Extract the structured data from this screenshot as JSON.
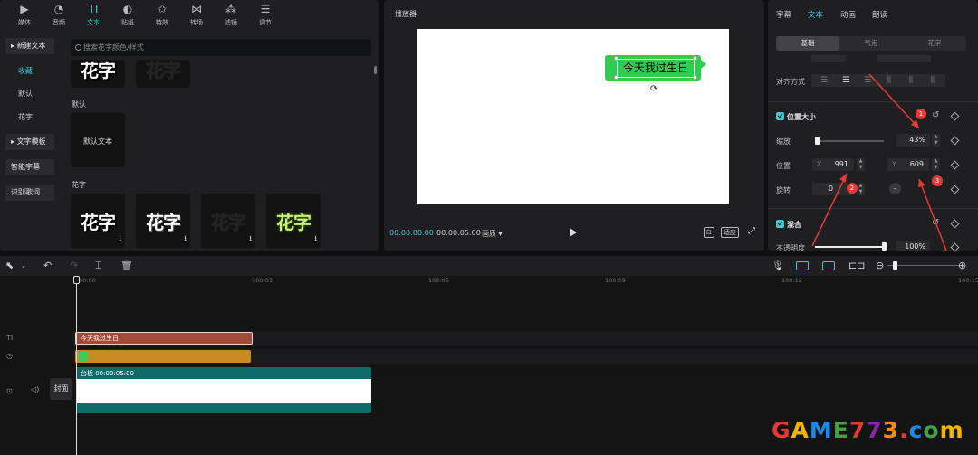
{
  "toolbar": {
    "tools": [
      {
        "label": "媒体",
        "icon": "media-icon",
        "glyph": "▶"
      },
      {
        "label": "音频",
        "icon": "audio-icon",
        "glyph": "◔"
      },
      {
        "label": "文本",
        "icon": "text-icon",
        "glyph": "TI"
      },
      {
        "label": "贴纸",
        "icon": "sticker-icon",
        "glyph": "◐"
      },
      {
        "label": "特效",
        "icon": "effects-icon",
        "glyph": "✩"
      },
      {
        "label": "转场",
        "icon": "transition-icon",
        "glyph": "⋈"
      },
      {
        "label": "滤镜",
        "icon": "filter-icon",
        "glyph": "⁂"
      },
      {
        "label": "调节",
        "icon": "adjust-icon",
        "glyph": "☰"
      }
    ],
    "active": "文本"
  },
  "left_nav": {
    "new_text": "新建文本",
    "favorites": "收藏",
    "default": "默认",
    "fancy": "花字",
    "text_template": "文字模板",
    "smart_caption": "智能字幕",
    "lyrics": "识别歌词"
  },
  "search": {
    "placeholder": "搜索花字颜色/样式"
  },
  "library": {
    "default_section": "默认",
    "default_tile": "默认文本",
    "fancy_section": "花字",
    "fancy_tiles": [
      "花字",
      "花字",
      "花字",
      "花字"
    ],
    "top_tiles": [
      "花字",
      "花字"
    ]
  },
  "player": {
    "title": "播放器",
    "caption_text": "今天我过生日",
    "time_current": "00:00:00:00",
    "time_total": "00:00:05:00",
    "ratio": "画质 ▾",
    "tools": [
      "⊡",
      "适应",
      "⤢"
    ]
  },
  "right_panel": {
    "tabs": [
      "字幕",
      "文本",
      "动画",
      "朗读"
    ],
    "active_tab": "文本",
    "segments": [
      "基础",
      "气泡",
      "花字"
    ],
    "active_segment": "基础",
    "align_label": "对齐方式",
    "pos_size_label": "位置大小",
    "scale_label": "缩放",
    "scale_value": "43%",
    "scale_level": 0.43,
    "position_label": "位置",
    "x_label": "X",
    "x_value": "991",
    "y_label": "Y",
    "y_value": "609",
    "rotate_label": "旋转",
    "rotate_value": "0",
    "mix_label": "混合",
    "opacity_label": "不透明度",
    "opacity_value": "100%",
    "opacity_level": 1.0
  },
  "annotations": [
    "1",
    "2",
    "3"
  ],
  "timeline": {
    "ruler": [
      "00:00",
      "100:03",
      "100:06",
      "100:09",
      "100:12",
      "100:15"
    ],
    "text_clip": "今天我过生日",
    "main_clip": "台板  00:00:05:00",
    "cover": "封面"
  },
  "watermark": {
    "text": "GAME773.com",
    "colors": [
      "#e53935",
      "#f4b400",
      "#1e88e5",
      "#43a047",
      "#e53935",
      "#8e24aa",
      "#fb8c00",
      "#e53935",
      "#1e88e5",
      "#43a047",
      "#f4b400"
    ]
  },
  "colors": {
    "accent": "#3ec8d8",
    "caption_bg": "#2ecc52",
    "text_clip": "#a34b38",
    "effect_clip": "#c88a23",
    "main_clip": "#0d6b68"
  }
}
